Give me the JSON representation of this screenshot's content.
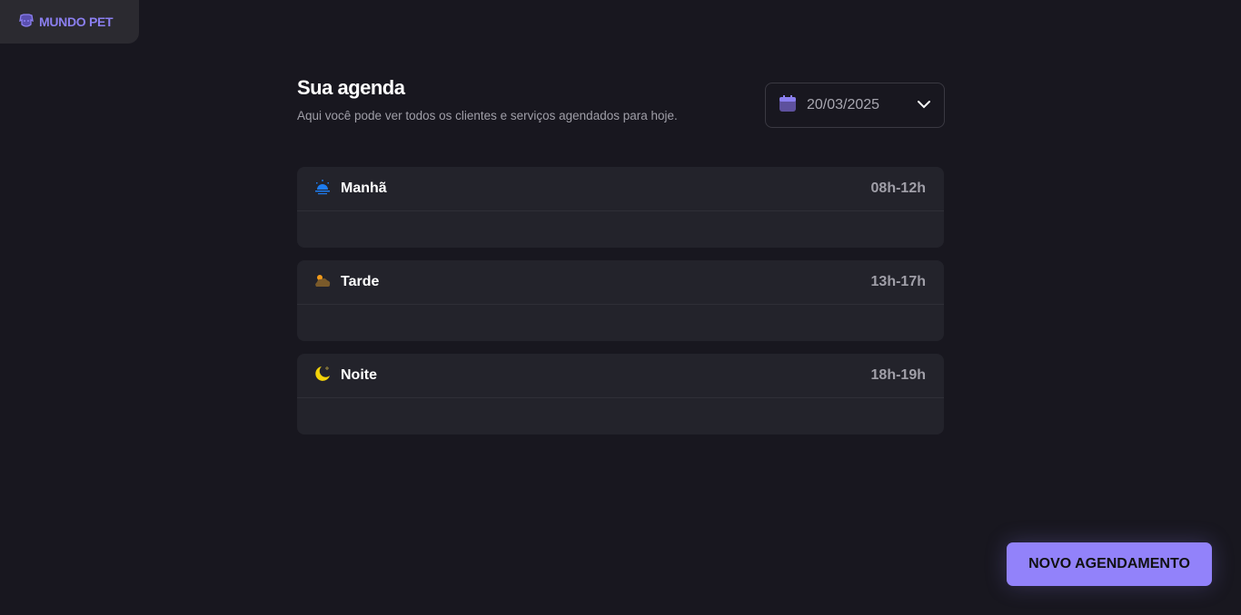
{
  "brand": {
    "name": "MUNDO PET",
    "icon": "dog-icon"
  },
  "header": {
    "title": "Sua agenda",
    "subtitle": "Aqui você pode ver todos os clientes e serviços agendados para hoje."
  },
  "date_picker": {
    "value": "20/03/2025",
    "icon": "calendar-icon"
  },
  "periods": [
    {
      "name": "Manhã",
      "range": "08h-12h",
      "icon": "sunrise-icon"
    },
    {
      "name": "Tarde",
      "range": "13h-17h",
      "icon": "cloud-sun-icon"
    },
    {
      "name": "Noite",
      "range": "18h-19h",
      "icon": "moon-icon"
    }
  ],
  "actions": {
    "new_label": "NOVO AGENDAMENTO"
  },
  "colors": {
    "accent": "#9282fa",
    "background": "#18171f",
    "card": "#23232b"
  }
}
